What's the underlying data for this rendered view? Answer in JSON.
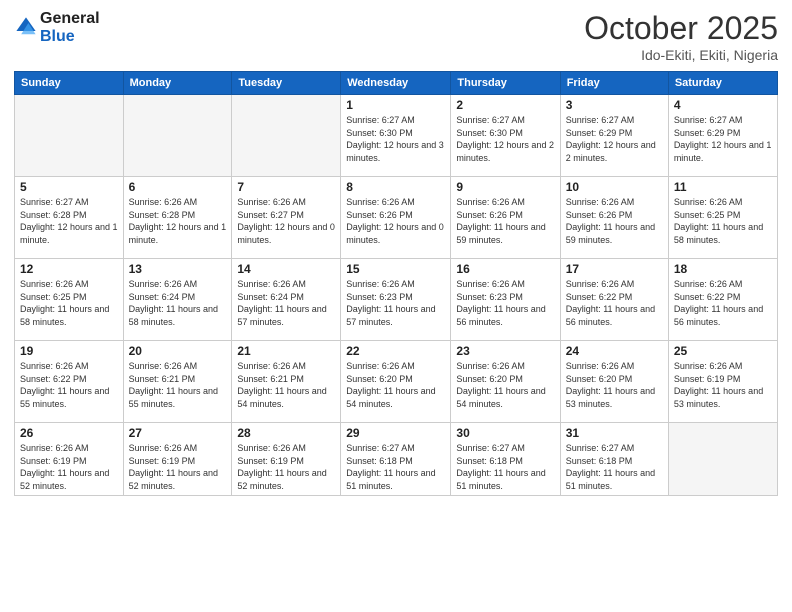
{
  "header": {
    "logo_line1": "General",
    "logo_line2": "Blue",
    "month": "October 2025",
    "location": "Ido-Ekiti, Ekiti, Nigeria"
  },
  "days_of_week": [
    "Sunday",
    "Monday",
    "Tuesday",
    "Wednesday",
    "Thursday",
    "Friday",
    "Saturday"
  ],
  "weeks": [
    [
      {
        "day": "",
        "info": ""
      },
      {
        "day": "",
        "info": ""
      },
      {
        "day": "",
        "info": ""
      },
      {
        "day": "1",
        "info": "Sunrise: 6:27 AM\nSunset: 6:30 PM\nDaylight: 12 hours and 3 minutes."
      },
      {
        "day": "2",
        "info": "Sunrise: 6:27 AM\nSunset: 6:30 PM\nDaylight: 12 hours and 2 minutes."
      },
      {
        "day": "3",
        "info": "Sunrise: 6:27 AM\nSunset: 6:29 PM\nDaylight: 12 hours and 2 minutes."
      },
      {
        "day": "4",
        "info": "Sunrise: 6:27 AM\nSunset: 6:29 PM\nDaylight: 12 hours and 1 minute."
      }
    ],
    [
      {
        "day": "5",
        "info": "Sunrise: 6:27 AM\nSunset: 6:28 PM\nDaylight: 12 hours and 1 minute."
      },
      {
        "day": "6",
        "info": "Sunrise: 6:26 AM\nSunset: 6:28 PM\nDaylight: 12 hours and 1 minute."
      },
      {
        "day": "7",
        "info": "Sunrise: 6:26 AM\nSunset: 6:27 PM\nDaylight: 12 hours and 0 minutes."
      },
      {
        "day": "8",
        "info": "Sunrise: 6:26 AM\nSunset: 6:26 PM\nDaylight: 12 hours and 0 minutes."
      },
      {
        "day": "9",
        "info": "Sunrise: 6:26 AM\nSunset: 6:26 PM\nDaylight: 11 hours and 59 minutes."
      },
      {
        "day": "10",
        "info": "Sunrise: 6:26 AM\nSunset: 6:26 PM\nDaylight: 11 hours and 59 minutes."
      },
      {
        "day": "11",
        "info": "Sunrise: 6:26 AM\nSunset: 6:25 PM\nDaylight: 11 hours and 58 minutes."
      }
    ],
    [
      {
        "day": "12",
        "info": "Sunrise: 6:26 AM\nSunset: 6:25 PM\nDaylight: 11 hours and 58 minutes."
      },
      {
        "day": "13",
        "info": "Sunrise: 6:26 AM\nSunset: 6:24 PM\nDaylight: 11 hours and 58 minutes."
      },
      {
        "day": "14",
        "info": "Sunrise: 6:26 AM\nSunset: 6:24 PM\nDaylight: 11 hours and 57 minutes."
      },
      {
        "day": "15",
        "info": "Sunrise: 6:26 AM\nSunset: 6:23 PM\nDaylight: 11 hours and 57 minutes."
      },
      {
        "day": "16",
        "info": "Sunrise: 6:26 AM\nSunset: 6:23 PM\nDaylight: 11 hours and 56 minutes."
      },
      {
        "day": "17",
        "info": "Sunrise: 6:26 AM\nSunset: 6:22 PM\nDaylight: 11 hours and 56 minutes."
      },
      {
        "day": "18",
        "info": "Sunrise: 6:26 AM\nSunset: 6:22 PM\nDaylight: 11 hours and 56 minutes."
      }
    ],
    [
      {
        "day": "19",
        "info": "Sunrise: 6:26 AM\nSunset: 6:22 PM\nDaylight: 11 hours and 55 minutes."
      },
      {
        "day": "20",
        "info": "Sunrise: 6:26 AM\nSunset: 6:21 PM\nDaylight: 11 hours and 55 minutes."
      },
      {
        "day": "21",
        "info": "Sunrise: 6:26 AM\nSunset: 6:21 PM\nDaylight: 11 hours and 54 minutes."
      },
      {
        "day": "22",
        "info": "Sunrise: 6:26 AM\nSunset: 6:20 PM\nDaylight: 11 hours and 54 minutes."
      },
      {
        "day": "23",
        "info": "Sunrise: 6:26 AM\nSunset: 6:20 PM\nDaylight: 11 hours and 54 minutes."
      },
      {
        "day": "24",
        "info": "Sunrise: 6:26 AM\nSunset: 6:20 PM\nDaylight: 11 hours and 53 minutes."
      },
      {
        "day": "25",
        "info": "Sunrise: 6:26 AM\nSunset: 6:19 PM\nDaylight: 11 hours and 53 minutes."
      }
    ],
    [
      {
        "day": "26",
        "info": "Sunrise: 6:26 AM\nSunset: 6:19 PM\nDaylight: 11 hours and 52 minutes."
      },
      {
        "day": "27",
        "info": "Sunrise: 6:26 AM\nSunset: 6:19 PM\nDaylight: 11 hours and 52 minutes."
      },
      {
        "day": "28",
        "info": "Sunrise: 6:26 AM\nSunset: 6:19 PM\nDaylight: 11 hours and 52 minutes."
      },
      {
        "day": "29",
        "info": "Sunrise: 6:27 AM\nSunset: 6:18 PM\nDaylight: 11 hours and 51 minutes."
      },
      {
        "day": "30",
        "info": "Sunrise: 6:27 AM\nSunset: 6:18 PM\nDaylight: 11 hours and 51 minutes."
      },
      {
        "day": "31",
        "info": "Sunrise: 6:27 AM\nSunset: 6:18 PM\nDaylight: 11 hours and 51 minutes."
      },
      {
        "day": "",
        "info": ""
      }
    ]
  ]
}
